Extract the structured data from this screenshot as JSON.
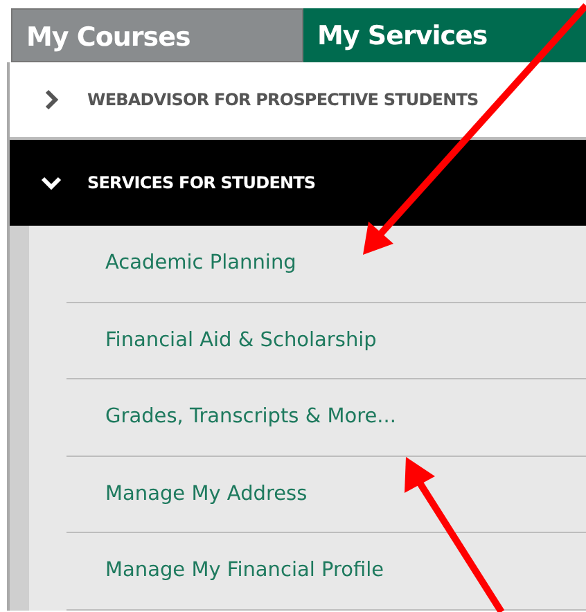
{
  "tabs": [
    {
      "label": "My Courses",
      "selected": false
    },
    {
      "label": "My Services",
      "selected": true
    }
  ],
  "sections": [
    {
      "title": "WEBADVISOR FOR PROSPECTIVE STUDENTS",
      "expanded": false
    },
    {
      "title": "SERVICES FOR STUDENTS",
      "expanded": true,
      "items": [
        "Academic Planning",
        "Financial Aid & Scholarship",
        "Grades, Transcripts & More...",
        "Manage My Address",
        "Manage My Financial Profile"
      ]
    }
  ]
}
